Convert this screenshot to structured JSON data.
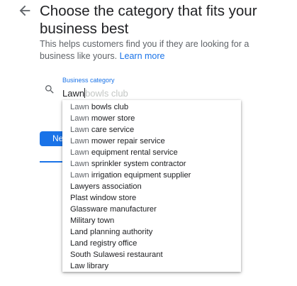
{
  "header": {
    "title": "Choose the category that fits your business best",
    "subtitle": "This helps customers find you if they are looking for a business like yours.",
    "learn_more": "Learn more"
  },
  "field": {
    "label": "Business category",
    "typed_value": "Lawn",
    "autocomplete_ghost": "bowls club"
  },
  "next_button": {
    "label": "Ne"
  },
  "suggestions": [
    {
      "prefix": "Lawn",
      "rest": " bowls club"
    },
    {
      "prefix": "Lawn",
      "rest": " mower store"
    },
    {
      "prefix": "Lawn",
      "rest": " care service"
    },
    {
      "prefix": "Lawn",
      "rest": " mower repair service"
    },
    {
      "prefix": "Lawn",
      "rest": " equipment rental service"
    },
    {
      "prefix": "Lawn",
      "rest": " sprinkler system contractor"
    },
    {
      "prefix": "Lawn",
      "rest": " irrigation equipment supplier"
    },
    {
      "prefix": "",
      "rest": "Lawyers association"
    },
    {
      "prefix": "",
      "rest": "Plast window store"
    },
    {
      "prefix": "",
      "rest": "Glassware manufacturer"
    },
    {
      "prefix": "",
      "rest": "Military town"
    },
    {
      "prefix": "",
      "rest": "Land planning authority"
    },
    {
      "prefix": "",
      "rest": "Land registry office"
    },
    {
      "prefix": "",
      "rest": "South Sulawesi restaurant"
    },
    {
      "prefix": "",
      "rest": "Law library"
    }
  ],
  "colors": {
    "accent": "#1a73e8",
    "text": "#202124",
    "muted": "#5f6368"
  },
  "icons": {
    "back": "arrow-back-icon",
    "search": "search-icon"
  }
}
